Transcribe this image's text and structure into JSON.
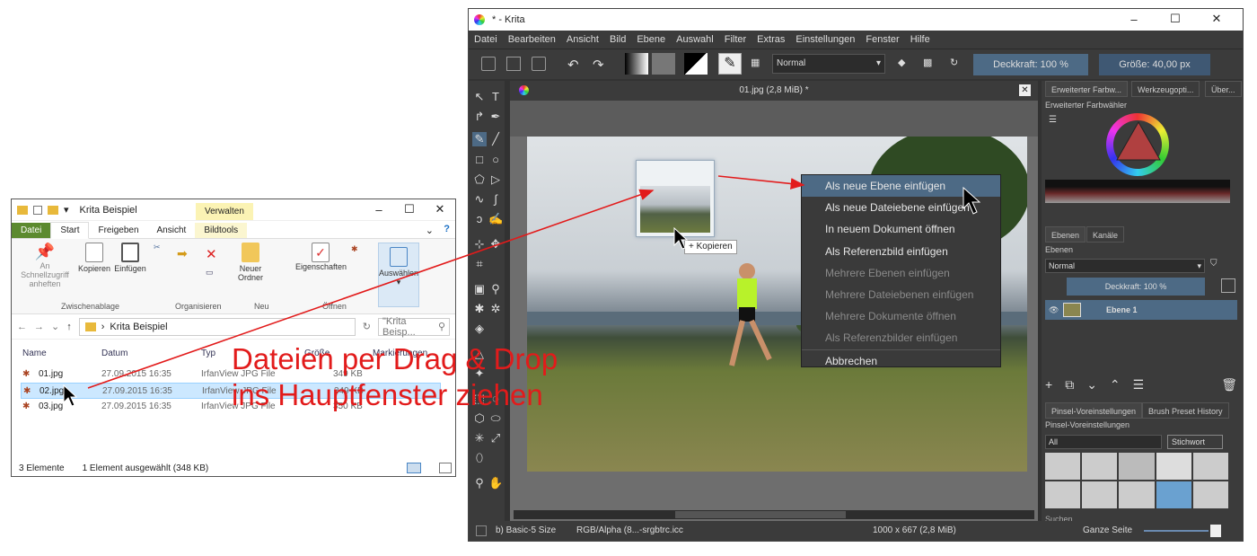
{
  "explorer": {
    "title": "Krita Beispiel",
    "ctx_tab": "Verwalten",
    "tabs": [
      "Datei",
      "Start",
      "Freigeben",
      "Ansicht",
      "Bildtools"
    ],
    "ribbon": {
      "pin": "An Schnellzugriff anheften",
      "copy": "Kopieren",
      "paste": "Einfügen",
      "group1": "Zwischenablage",
      "group2": "Organisieren",
      "newfolder": "Neuer Ordner",
      "group3": "Neu",
      "props": "Eigenschaften",
      "group4": "Öffnen",
      "select": "Auswählen"
    },
    "path": "Krita Beispiel",
    "search": "\"Krita Beisp...",
    "cols": [
      "Name",
      "Datum",
      "Typ",
      "Größe",
      "Markierungen"
    ],
    "files": [
      {
        "name": "01.jpg",
        "date": "27.09.2015 16:35",
        "type": "IrfanView JPG File",
        "size": "349 KB"
      },
      {
        "name": "02.jpg",
        "date": "27.09.2015 16:35",
        "type": "IrfanView JPG File",
        "size": "349 KB"
      },
      {
        "name": "03.jpg",
        "date": "27.09.2015 16:35",
        "type": "IrfanView JPG File",
        "size": "350 KB"
      }
    ],
    "status_count": "3 Elemente",
    "status_sel": "1 Element ausgewählt (348 KB)"
  },
  "krita": {
    "title": "* - Krita",
    "menu": [
      "Datei",
      "Bearbeiten",
      "Ansicht",
      "Bild",
      "Ebene",
      "Auswahl",
      "Filter",
      "Extras",
      "Einstellungen",
      "Fenster",
      "Hilfe"
    ],
    "blend": "Normal",
    "opacity": "Deckkraft: 100 %",
    "size": "Größe: 40,00 px",
    "doc_tab": "01.jpg (2,8 MiB) *",
    "dock_tabs": [
      "Erweiterter Farbw...",
      "Werkzeugopti...",
      "Über..."
    ],
    "color_title": "Erweiterter Farbwähler",
    "layer_tabs": [
      "Ebenen",
      "Kanäle"
    ],
    "layers_title": "Ebenen",
    "layer_blend": "Normal",
    "layer_opacity": "Deckkraft:  100 %",
    "layer_name": "Ebene 1",
    "preset_tabs": [
      "Pinsel-Voreinstellungen",
      "Brush Preset History"
    ],
    "preset_title": "Pinsel-Voreinstellungen",
    "preset_filter": "All",
    "preset_tag": "Stichwort",
    "search": "Suchen",
    "status_brush": "b) Basic-5 Size",
    "status_color": "RGB/Alpha (8...-srgbtrc.icc",
    "status_dim": "1000 x 667 (2,8 MiB)",
    "status_zoom": "Ganze Seite"
  },
  "context_menu": [
    {
      "label": "Als neue Ebene einfügen",
      "enabled": true,
      "highlighted": true
    },
    {
      "label": "Als neue Dateiebene einfügen",
      "enabled": true
    },
    {
      "label": "In neuem Dokument öffnen",
      "enabled": true
    },
    {
      "label": "Als Referenzbild einfügen",
      "enabled": true
    },
    {
      "label": "Mehrere Ebenen einfügen",
      "enabled": false
    },
    {
      "label": "Mehrere Dateiebenen einfügen",
      "enabled": false
    },
    {
      "label": "Mehrere Dokumente öffnen",
      "enabled": false
    },
    {
      "label": "Als Referenzbilder einfügen",
      "enabled": false
    },
    {
      "label": "Abbrechen",
      "enabled": true
    }
  ],
  "drag_badge": "+ Kopieren",
  "annotation": {
    "line1": "Dateien per Drag & Drop",
    "line2": "ins Hauptfenster ziehen"
  },
  "colors": {
    "annotation": "#e21b1b",
    "highlight": "#4d6a85",
    "explorer_file_tab": "#5c8a2f"
  }
}
